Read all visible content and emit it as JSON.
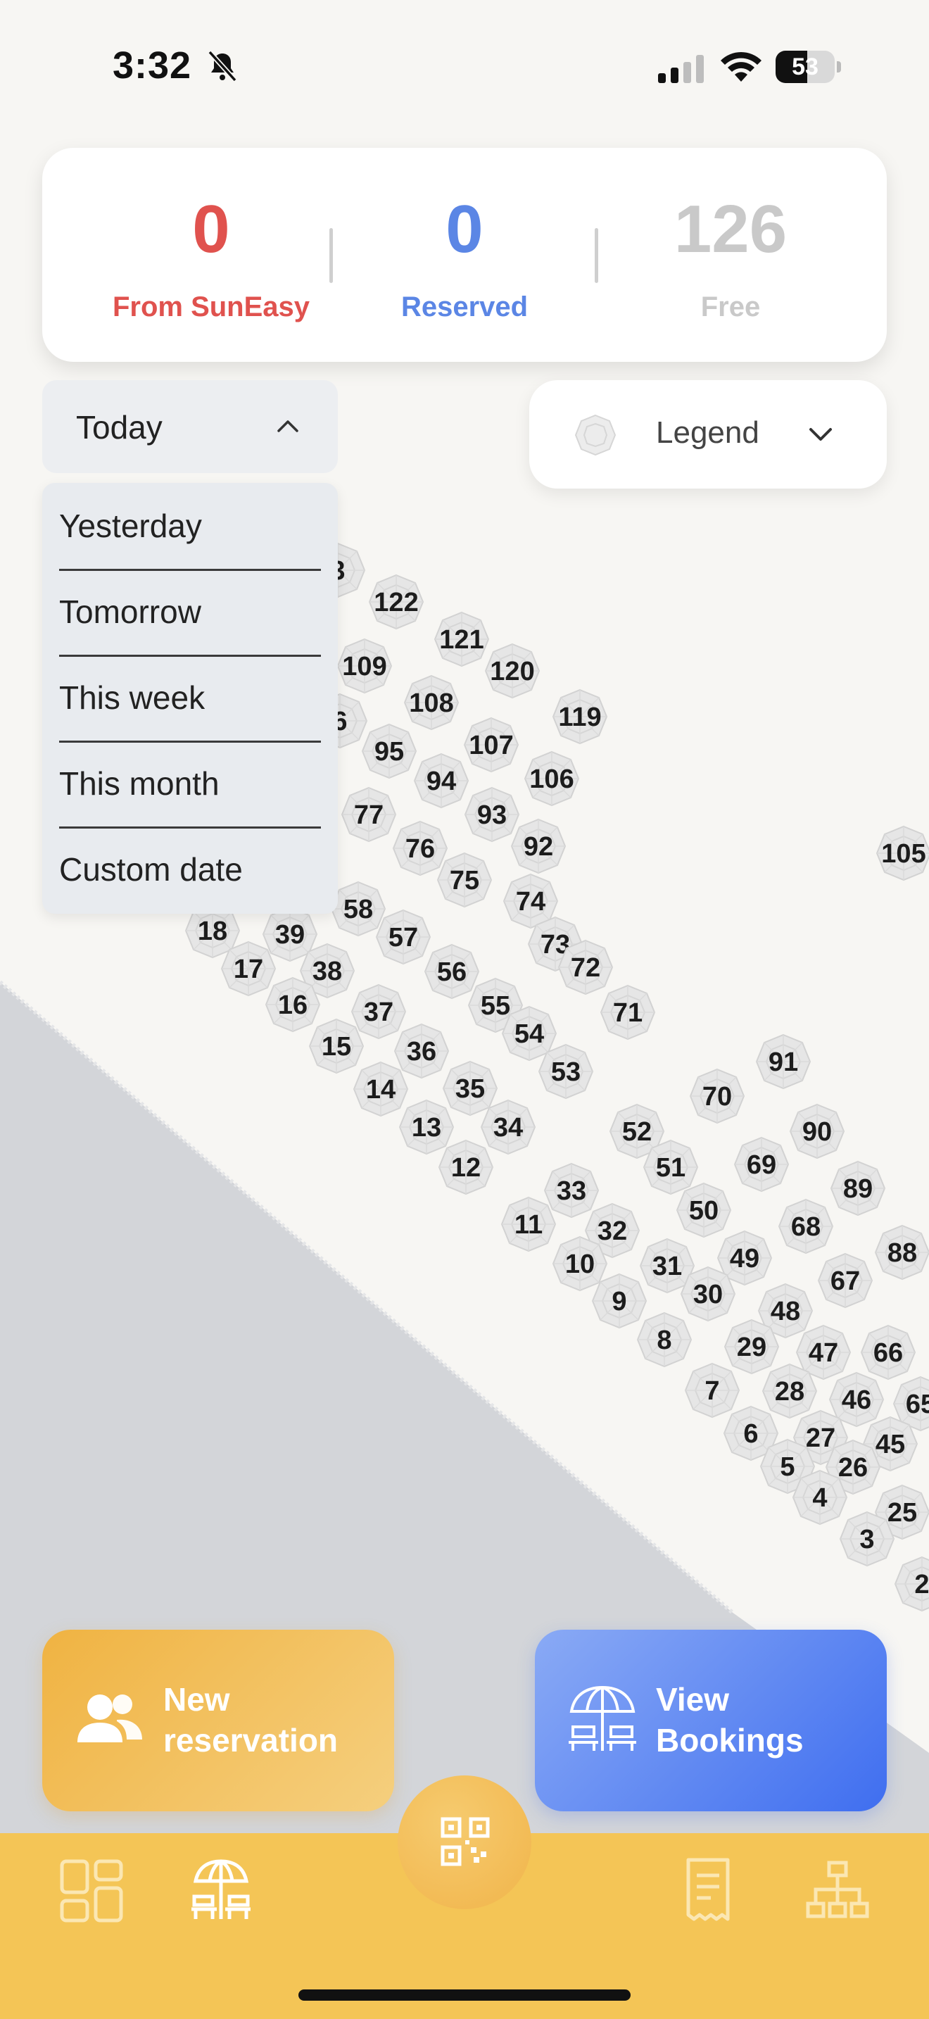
{
  "status_bar": {
    "time": "3:32",
    "battery": "53",
    "battery_level_percent": 53
  },
  "stats": {
    "from_suneasy": {
      "value": "0",
      "label": "From SunEasy",
      "color": "#e0524e"
    },
    "reserved": {
      "value": "0",
      "label": "Reserved",
      "color": "#5b86e5"
    },
    "free": {
      "value": "126",
      "label": "Free",
      "color": "#c9c9c9"
    }
  },
  "date_filter": {
    "selected": "Today",
    "options": [
      "Yesterday",
      "Tomorrow",
      "This week",
      "This month",
      "Custom date"
    ]
  },
  "legend": {
    "label": "Legend"
  },
  "umbrellas": [
    "3",
    "122",
    "121",
    "109",
    "120",
    "6",
    "108",
    "119",
    "95",
    "107",
    "94",
    "106",
    "93",
    "77",
    "92",
    "76",
    "105",
    "75",
    "74",
    "58",
    "18",
    "39",
    "57",
    "73",
    "72",
    "17",
    "38",
    "56",
    "16",
    "55",
    "37",
    "71",
    "54",
    "15",
    "36",
    "53",
    "91",
    "35",
    "14",
    "70",
    "34",
    "13",
    "52",
    "90",
    "51",
    "69",
    "12",
    "89",
    "33",
    "50",
    "68",
    "11",
    "32",
    "88",
    "10",
    "31",
    "49",
    "67",
    "9",
    "30",
    "48",
    "8",
    "29",
    "47",
    "66",
    "7",
    "28",
    "46",
    "65",
    "6",
    "27",
    "45",
    "5",
    "26",
    "4",
    "25",
    "3",
    "2"
  ],
  "actions": {
    "new_reservation": "New reservation",
    "view_bookings": "View Bookings"
  },
  "colors": {
    "nav_bar": "#f4c556",
    "new_btn": "#f0b342",
    "view_btn": "#3f6ef0"
  }
}
